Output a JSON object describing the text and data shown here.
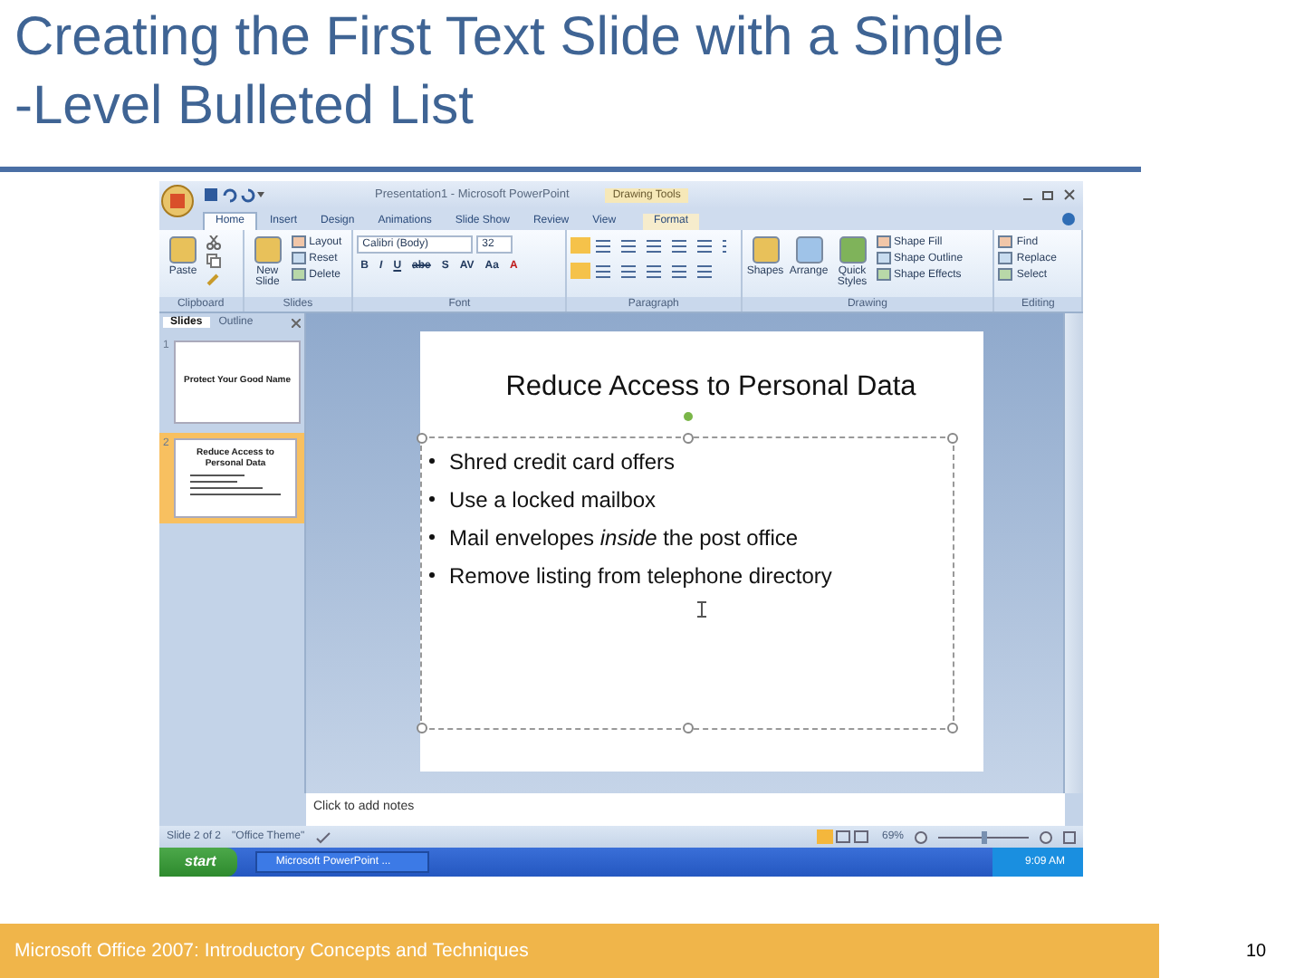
{
  "title_lines": [
    "Creating the First Text Slide with a Single",
    "-Level Bulleted List"
  ],
  "window": {
    "title": "Presentation1 - Microsoft PowerPoint",
    "context_group": "Drawing Tools"
  },
  "ribbon_tabs": [
    {
      "label": "Home",
      "selected": true
    },
    {
      "label": "Insert",
      "selected": false
    },
    {
      "label": "Design",
      "selected": false
    },
    {
      "label": "Animations",
      "selected": false
    },
    {
      "label": "Slide Show",
      "selected": false
    },
    {
      "label": "Review",
      "selected": false
    },
    {
      "label": "View",
      "selected": false
    },
    {
      "label": "Format",
      "selected": false
    }
  ],
  "ribbon_groups": [
    {
      "kind": "buttons",
      "name": "Clipboard",
      "large": [
        "Paste"
      ]
    },
    {
      "kind": "buttons",
      "name": "Slides",
      "large": [
        "New Slide"
      ],
      "small": [
        "Layout",
        "Reset",
        "Delete"
      ]
    },
    {
      "kind": "font",
      "name": "Font",
      "font": "Calibri (Body)",
      "size": "32",
      "formats": [
        "B",
        "I",
        "U",
        "abe",
        "S",
        "AV",
        "Aa",
        "A"
      ]
    },
    {
      "kind": "icons",
      "name": "Paragraph"
    },
    {
      "kind": "buttons",
      "name": "Drawing",
      "large": [
        "Shapes",
        "Arrange",
        "Quick Styles"
      ],
      "small": [
        "Shape Fill",
        "Shape Outline",
        "Shape Effects"
      ]
    },
    {
      "kind": "buttons",
      "name": "Editing",
      "small": [
        "Find",
        "Replace",
        "Select"
      ]
    }
  ],
  "pane_tabs": [
    {
      "label": "Slides",
      "selected": true
    },
    {
      "label": "Outline",
      "selected": false
    }
  ],
  "thumbnails": [
    {
      "number": "1",
      "title": "Protect Your Good Name",
      "selected": false,
      "has_bullets": false
    },
    {
      "number": "2",
      "title": "Reduce Access to Personal Data",
      "selected": true,
      "has_bullets": true
    }
  ],
  "slide": {
    "title": "Reduce Access to Personal Data",
    "bullets": [
      "Shred credit card offers",
      "Use a locked mailbox",
      "Mail envelopes *inside* the post office",
      "Remove listing from telephone directory"
    ]
  },
  "notes": {
    "placeholder": "Click to add notes"
  },
  "status_bar": {
    "items": [
      "Slide 2 of 2",
      "\"Office Theme\""
    ],
    "zoom": "69%",
    "zoom_level": {
      "level": 0.5
    }
  },
  "taskbar": {
    "start": "start",
    "task": "Microsoft PowerPoint ...",
    "clock": "9:09 AM"
  },
  "footer": {
    "text": "Microsoft Office 2007: Introductory Concepts and Techniques",
    "page": "10"
  }
}
